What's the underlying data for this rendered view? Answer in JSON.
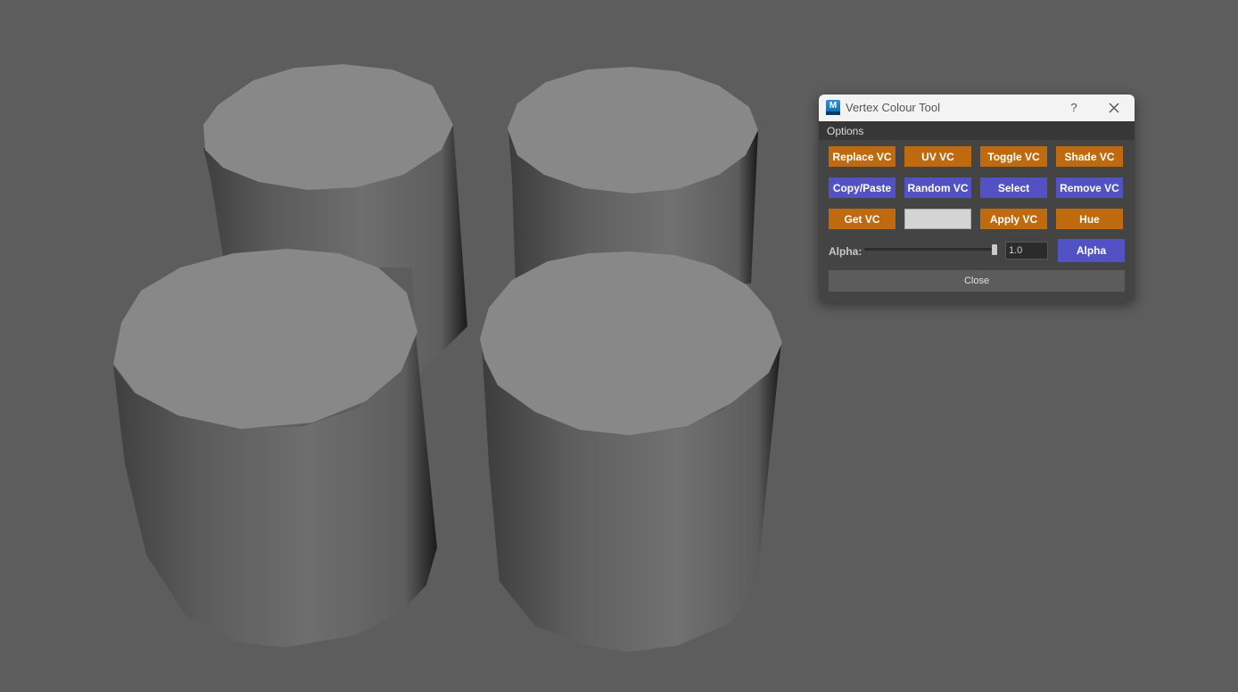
{
  "dialog": {
    "title": "Vertex Colour Tool",
    "app_icon_letter": "M",
    "help_label": "?",
    "menu": {
      "options_label": "Options"
    },
    "buttons": {
      "row1": [
        "Replace VC",
        "UV VC",
        "Toggle VC",
        "Shade VC"
      ],
      "row2": [
        "Copy/Paste",
        "Random VC",
        "Select",
        "Remove VC"
      ],
      "row3": [
        "Get VC",
        "",
        "Apply VC",
        "Hue"
      ]
    },
    "alpha": {
      "label": "Alpha:",
      "value": "1.0",
      "slider_fraction": 1.0,
      "button_label": "Alpha"
    },
    "close_label": "Close",
    "colors": {
      "orange_button": "#bf6a0f",
      "blue_button": "#5352c4",
      "swatch": "#d4d4d4"
    }
  },
  "viewport": {
    "background": "#5d5d5d",
    "objects": [
      "cylinder",
      "cylinder",
      "cylinder",
      "cylinder"
    ]
  }
}
